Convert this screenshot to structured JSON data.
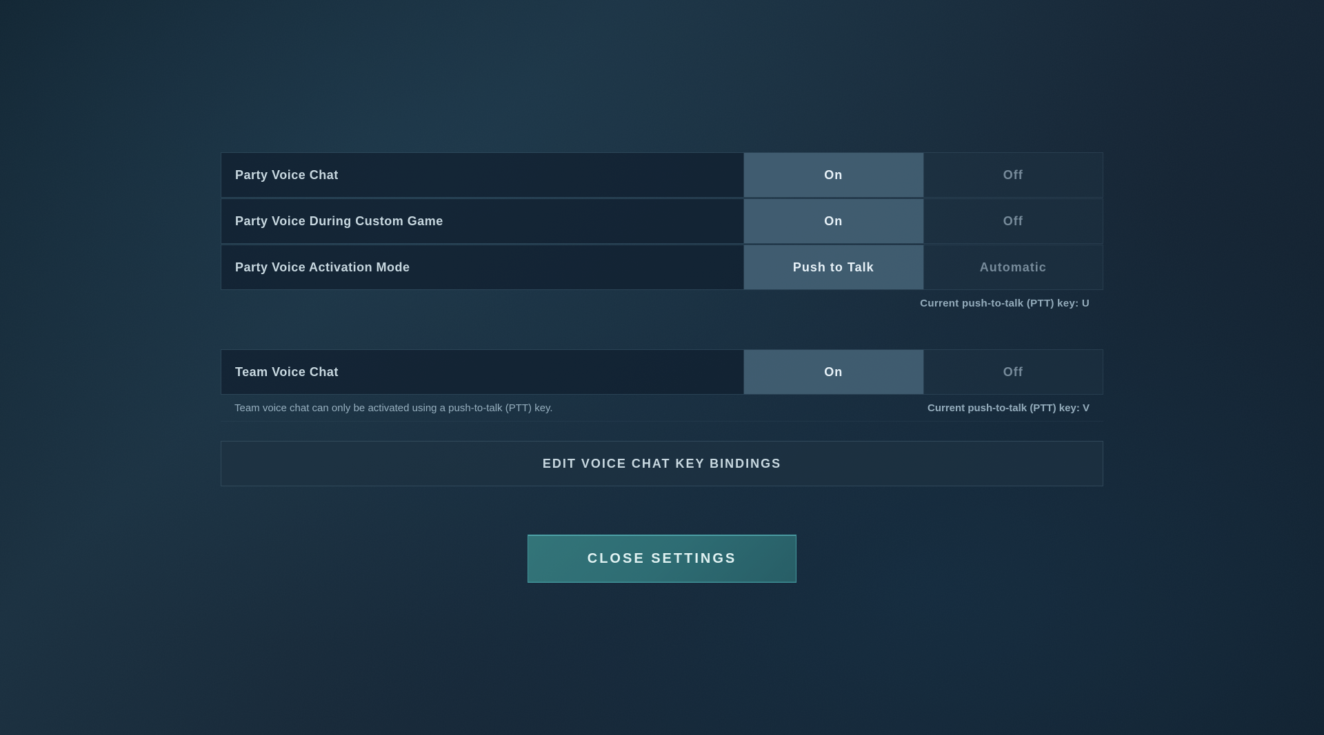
{
  "settings": {
    "party_voice_chat": {
      "label": "Party Voice Chat",
      "active": "On",
      "inactive": "Off"
    },
    "party_voice_during_custom": {
      "label": "Party Voice During Custom Game",
      "active": "On",
      "inactive": "Off"
    },
    "party_voice_activation": {
      "label": "Party Voice Activation Mode",
      "active": "Push to Talk",
      "inactive": "Automatic"
    },
    "ptt_info": "Current push-to-talk (PTT) key: U",
    "team_voice_chat": {
      "label": "Team Voice Chat",
      "active": "On",
      "inactive": "Off"
    },
    "team_voice_note": "Team voice chat can only be activated using a push-to-talk (PTT) key.",
    "team_ptt_info": "Current push-to-talk (PTT) key: V"
  },
  "buttons": {
    "edit_keybindings": "EDIT VOICE CHAT KEY BINDINGS",
    "close_settings": "CLOSE SETTINGS"
  }
}
